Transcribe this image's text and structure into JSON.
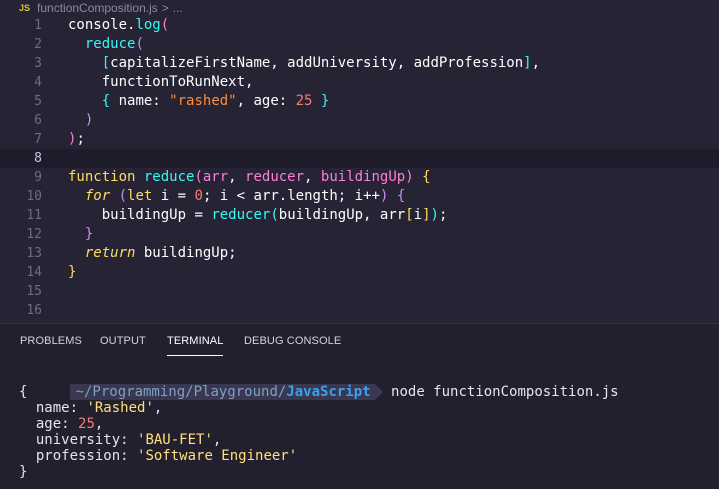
{
  "breadcrumb": {
    "lang": "JS",
    "file": "functionComposition.js",
    "sep": ">",
    "more": "..."
  },
  "editor": {
    "line_numbers": [
      "1",
      "2",
      "3",
      "4",
      "5",
      "6",
      "7",
      "8",
      "9",
      "10",
      "11",
      "12",
      "13",
      "14",
      "15",
      "16"
    ],
    "lines": [
      [
        {
          "t": "console.",
          "c": "#fefefe"
        },
        {
          "t": "log",
          "c": "#36f9f6"
        },
        {
          "t": "(",
          "c": "#ff7edb"
        }
      ],
      [
        {
          "t": "  ",
          "c": "#fefefe"
        },
        {
          "t": "reduce",
          "c": "#36f9f6"
        },
        {
          "t": "(",
          "c": "#c792ea"
        }
      ],
      [
        {
          "t": "    ",
          "c": "#fefefe"
        },
        {
          "t": "[",
          "c": "#36f9f6"
        },
        {
          "t": "capitalizeFirstName, addUniversity, addProfession",
          "c": "#fefefe"
        },
        {
          "t": "]",
          "c": "#36f9f6"
        },
        {
          "t": ",",
          "c": "#fefefe"
        }
      ],
      [
        {
          "t": "    functionToRunNext,",
          "c": "#fefefe"
        }
      ],
      [
        {
          "t": "    ",
          "c": "#fefefe"
        },
        {
          "t": "{",
          "c": "#36f9f6"
        },
        {
          "t": " name: ",
          "c": "#fefefe"
        },
        {
          "t": "\"rashed\"",
          "c": "#ff8b39"
        },
        {
          "t": ", age: ",
          "c": "#fefefe"
        },
        {
          "t": "25",
          "c": "#f97e72"
        },
        {
          "t": " ",
          "c": "#fefefe"
        },
        {
          "t": "}",
          "c": "#36f9f6"
        }
      ],
      [
        {
          "t": "  ",
          "c": "#fefefe"
        },
        {
          "t": ")",
          "c": "#c792ea"
        }
      ],
      [
        {
          "t": ")",
          "c": "#ff7edb"
        },
        {
          "t": ";",
          "c": "#fefefe"
        }
      ],
      [],
      [
        {
          "t": "function ",
          "c": "#fede5d"
        },
        {
          "t": "reduce",
          "c": "#36f9f6"
        },
        {
          "t": "(",
          "c": "#ff7edb"
        },
        {
          "t": "arr",
          "c": "#ff7edb"
        },
        {
          "t": ", ",
          "c": "#fefefe"
        },
        {
          "t": "reducer",
          "c": "#ff7edb"
        },
        {
          "t": ", ",
          "c": "#fefefe"
        },
        {
          "t": "buildingUp",
          "c": "#ff7edb"
        },
        {
          "t": ")",
          "c": "#ff7edb"
        },
        {
          "t": " ",
          "c": "#fefefe"
        },
        {
          "t": "{",
          "c": "#fede5d"
        }
      ],
      [
        {
          "t": "  ",
          "c": "#fefefe"
        },
        {
          "t": "for",
          "c": "#fede5d",
          "i": true
        },
        {
          "t": " ",
          "c": "#fefefe"
        },
        {
          "t": "(",
          "c": "#c792ea"
        },
        {
          "t": "let",
          "c": "#fede5d"
        },
        {
          "t": " i ",
          "c": "#fefefe"
        },
        {
          "t": "=",
          "c": "#fefefe"
        },
        {
          "t": " ",
          "c": "#fefefe"
        },
        {
          "t": "0",
          "c": "#f97e72"
        },
        {
          "t": "; i ",
          "c": "#fefefe"
        },
        {
          "t": "<",
          "c": "#fefefe"
        },
        {
          "t": " arr.length; i",
          "c": "#fefefe"
        },
        {
          "t": "++",
          "c": "#fefefe"
        },
        {
          "t": ")",
          "c": "#c792ea"
        },
        {
          "t": " ",
          "c": "#fefefe"
        },
        {
          "t": "{",
          "c": "#c792ea"
        }
      ],
      [
        {
          "t": "    buildingUp ",
          "c": "#fefefe"
        },
        {
          "t": "=",
          "c": "#fefefe"
        },
        {
          "t": " ",
          "c": "#fefefe"
        },
        {
          "t": "reducer",
          "c": "#36f9f6"
        },
        {
          "t": "(",
          "c": "#36f9f6"
        },
        {
          "t": "buildingUp, arr",
          "c": "#fefefe"
        },
        {
          "t": "[",
          "c": "#fede5d"
        },
        {
          "t": "i",
          "c": "#fefefe"
        },
        {
          "t": "]",
          "c": "#fede5d"
        },
        {
          "t": ")",
          "c": "#36f9f6"
        },
        {
          "t": ";",
          "c": "#fefefe"
        }
      ],
      [
        {
          "t": "  ",
          "c": "#fefefe"
        },
        {
          "t": "}",
          "c": "#c792ea"
        }
      ],
      [
        {
          "t": "  ",
          "c": "#fefefe"
        },
        {
          "t": "return",
          "c": "#fede5d",
          "i": true
        },
        {
          "t": " buildingUp;",
          "c": "#fefefe"
        }
      ],
      [
        {
          "t": "}",
          "c": "#fede5d"
        }
      ],
      [],
      []
    ]
  },
  "panel": {
    "tabs": [
      "PROBLEMS",
      "OUTPUT",
      "TERMINAL",
      "DEBUG CONSOLE"
    ],
    "active_tab": "TERMINAL"
  },
  "terminal": {
    "prompt_path": "~/Programming/Playground/",
    "prompt_cwd": "JavaScript",
    "command": "node functionComposition.js",
    "output": [
      {
        "pre": "{"
      },
      {
        "pre": "  name: ",
        "val": "'Rashed'",
        "vtype": "str",
        "post": ","
      },
      {
        "pre": "  age: ",
        "val": "25",
        "vtype": "num",
        "post": ","
      },
      {
        "pre": "  university: ",
        "val": "'BAU-FET'",
        "vtype": "str",
        "post": ","
      },
      {
        "pre": "  profession: ",
        "val": "'Software Engineer'",
        "vtype": "str",
        "post": ""
      },
      {
        "pre": "}"
      }
    ]
  },
  "colors": {
    "editor_bg": "#262335",
    "panel_bg": "#221f2f",
    "current_line_bg": "#1e1b2b"
  }
}
